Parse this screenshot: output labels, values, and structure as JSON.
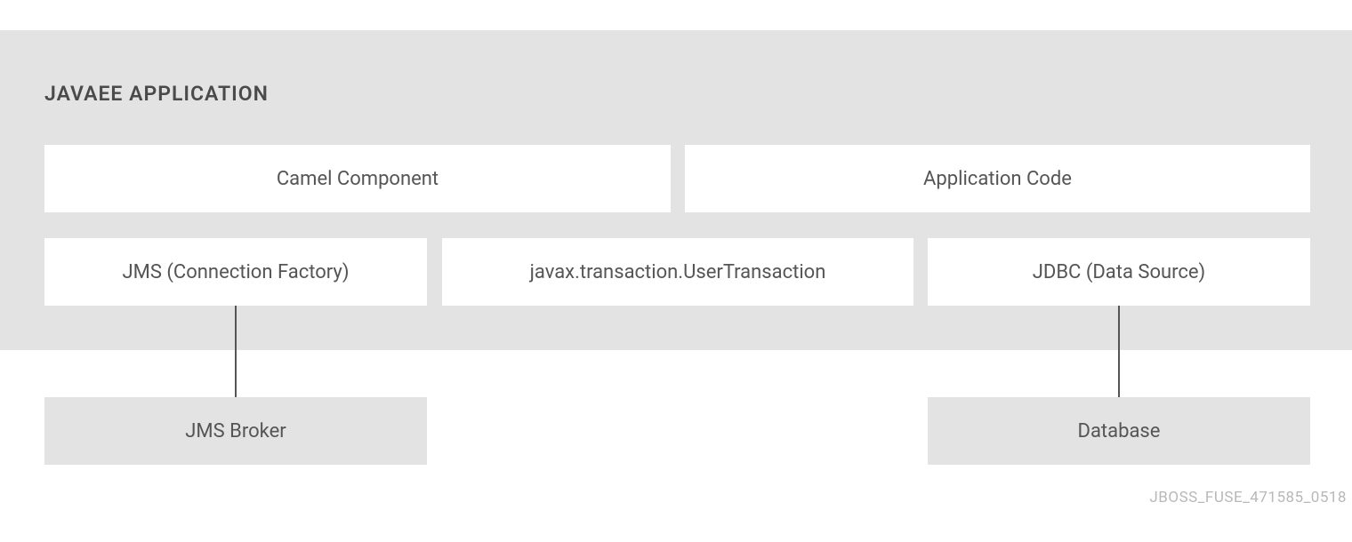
{
  "diagram": {
    "title": "JAVAEE APPLICATION",
    "boxes": {
      "camel_component": "Camel Component",
      "application_code": "Application Code",
      "jms_factory": "JMS (Connection Factory)",
      "user_transaction": "javax.transaction.UserTransaction",
      "jdbc_source": "JDBC (Data Source)",
      "jms_broker": "JMS Broker",
      "database": "Database"
    },
    "footer": "JBOSS_FUSE_471585_0518"
  }
}
